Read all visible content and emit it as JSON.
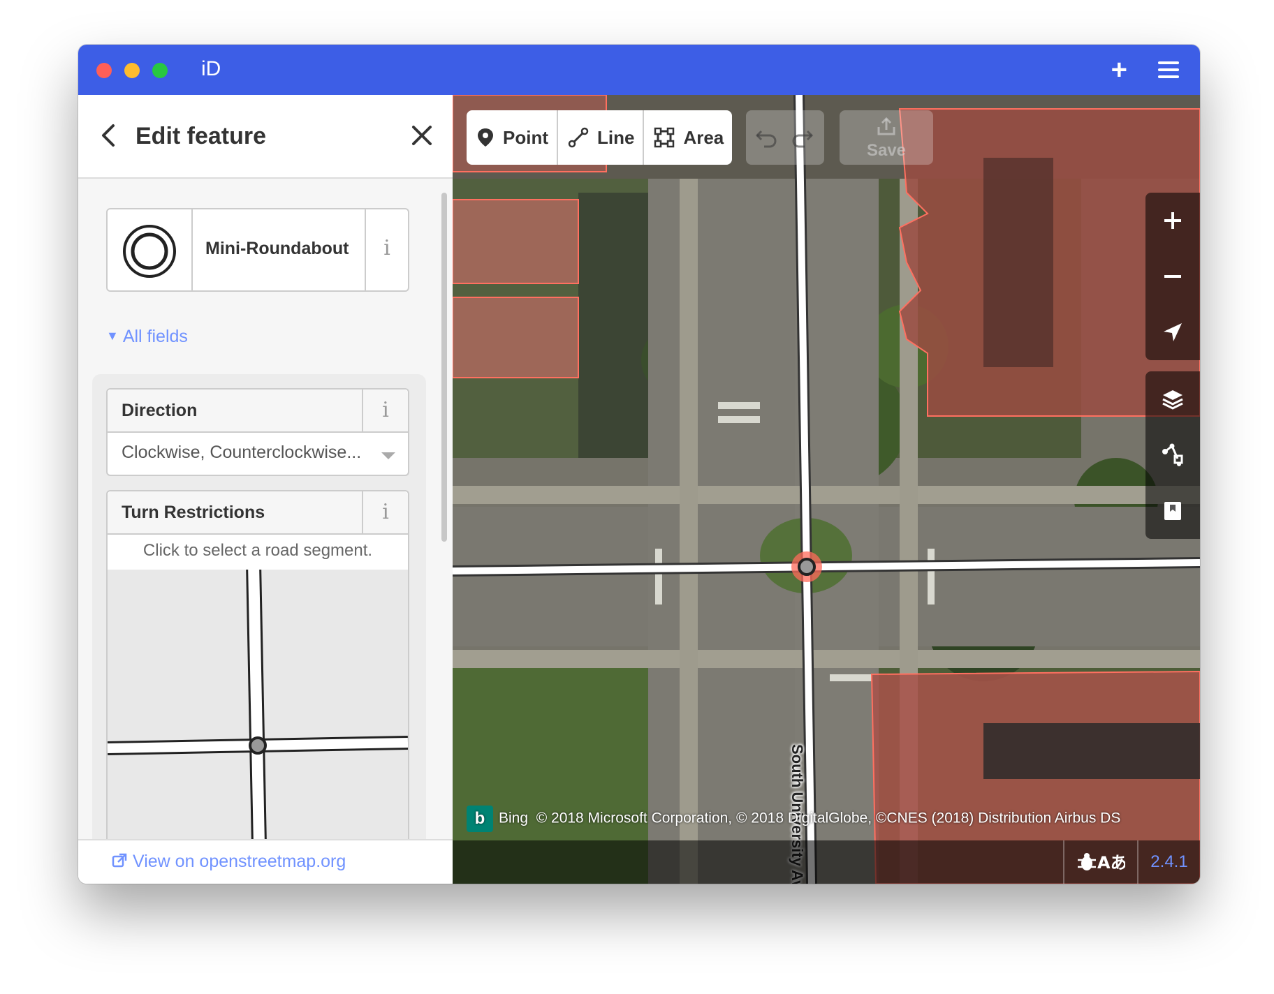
{
  "window": {
    "title": "iD"
  },
  "sidebar": {
    "header_title": "Edit feature",
    "preset_name": "Mini-Roundabout",
    "info_glyph": "i",
    "all_fields_label": "All fields",
    "fields": {
      "direction": {
        "label": "Direction",
        "value": "Clockwise, Counterclockwise..."
      },
      "turn_restrictions": {
        "label": "Turn Restrictions",
        "hint": "Click to select a road segment."
      }
    },
    "footer_link": "View on openstreetmap.org"
  },
  "toolbar": {
    "point_label": "Point",
    "line_label": "Line",
    "area_label": "Area",
    "save_label": "Save"
  },
  "map": {
    "street_name": "South University Avenue",
    "attribution_brand": "Bing",
    "attribution_text": "© 2018 Microsoft Corporation, © 2018 DigitalGlobe, ©CNES (2018) Distribution Airbus DS",
    "version": "2.4.1"
  },
  "icons": {
    "back": "chevron-left-icon",
    "close": "close-icon",
    "preset": "mini-roundabout-icon",
    "point": "map-pin-icon",
    "line": "line-icon",
    "area": "area-icon",
    "zoom_in": "plus-icon",
    "zoom_out": "minus-icon",
    "geolocate": "location-arrow-icon",
    "layers": "layers-icon",
    "data": "map-data-icon",
    "help": "bookmark-help-icon",
    "issues": "bug-icon",
    "translate": "translate-icon"
  },
  "colors": {
    "titlebar": "#3d5ee6",
    "link": "#7092ff",
    "building_highlight": "#e06050"
  }
}
